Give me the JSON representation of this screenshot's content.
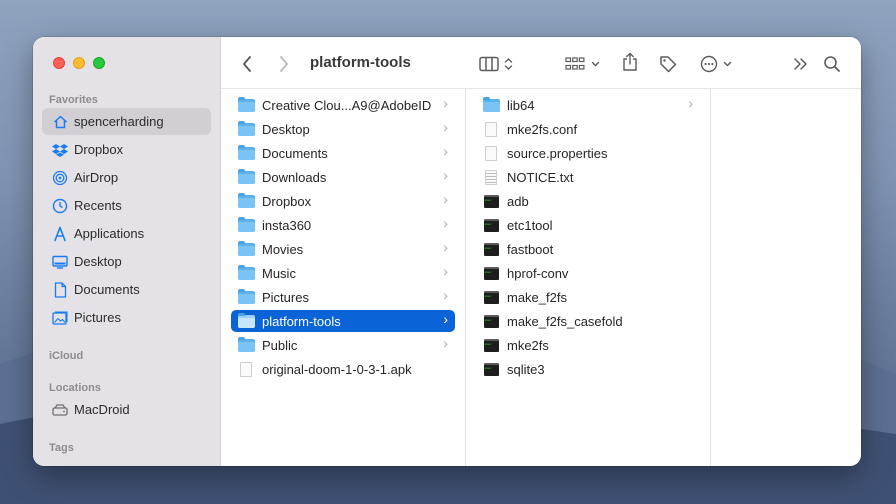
{
  "window": {
    "title": "platform-tools"
  },
  "sidebar": {
    "favorites_heading": "Favorites",
    "favorites": [
      {
        "label": "spencerharding",
        "icon": "home-icon",
        "selected": true
      },
      {
        "label": "Dropbox",
        "icon": "dropbox-icon"
      },
      {
        "label": "AirDrop",
        "icon": "airdrop-icon"
      },
      {
        "label": "Recents",
        "icon": "clock-icon"
      },
      {
        "label": "Applications",
        "icon": "applications-icon"
      },
      {
        "label": "Desktop",
        "icon": "desktop-icon"
      },
      {
        "label": "Documents",
        "icon": "document-icon"
      },
      {
        "label": "Pictures",
        "icon": "pictures-icon"
      }
    ],
    "icloud_heading": "iCloud",
    "locations_heading": "Locations",
    "locations": [
      {
        "label": "MacDroid",
        "icon": "drive-icon"
      }
    ],
    "tags_heading": "Tags"
  },
  "column1": [
    {
      "label": "Creative Clou...A9@AdobeID",
      "type": "folder",
      "has_children": true
    },
    {
      "label": "Desktop",
      "type": "folder",
      "has_children": true
    },
    {
      "label": "Documents",
      "type": "folder",
      "has_children": true
    },
    {
      "label": "Downloads",
      "type": "folder",
      "has_children": true
    },
    {
      "label": "Dropbox",
      "type": "folder",
      "has_children": true
    },
    {
      "label": "insta360",
      "type": "folder",
      "has_children": true
    },
    {
      "label": "Movies",
      "type": "folder",
      "has_children": true
    },
    {
      "label": "Music",
      "type": "folder",
      "has_children": true
    },
    {
      "label": "Pictures",
      "type": "folder",
      "has_children": true
    },
    {
      "label": "platform-tools",
      "type": "folder",
      "has_children": true,
      "selected": true
    },
    {
      "label": "Public",
      "type": "folder",
      "has_children": true
    },
    {
      "label": "original-doom-1-0-3-1.apk",
      "type": "file",
      "has_children": false
    }
  ],
  "column2": [
    {
      "label": "lib64",
      "type": "folder",
      "has_children": true
    },
    {
      "label": "mke2fs.conf",
      "type": "file"
    },
    {
      "label": "source.properties",
      "type": "file"
    },
    {
      "label": "NOTICE.txt",
      "type": "text"
    },
    {
      "label": "adb",
      "type": "exec"
    },
    {
      "label": "etc1tool",
      "type": "exec"
    },
    {
      "label": "fastboot",
      "type": "exec"
    },
    {
      "label": "hprof-conv",
      "type": "exec"
    },
    {
      "label": "make_f2fs",
      "type": "exec"
    },
    {
      "label": "make_f2fs_casefold",
      "type": "exec"
    },
    {
      "label": "mke2fs",
      "type": "exec"
    },
    {
      "label": "sqlite3",
      "type": "exec"
    }
  ],
  "colors": {
    "selection": "#0a64d7",
    "sidebar_bg": "#e4e2e6",
    "accent_icon": "#1a7cf5",
    "folder": "#5ab2ee"
  }
}
